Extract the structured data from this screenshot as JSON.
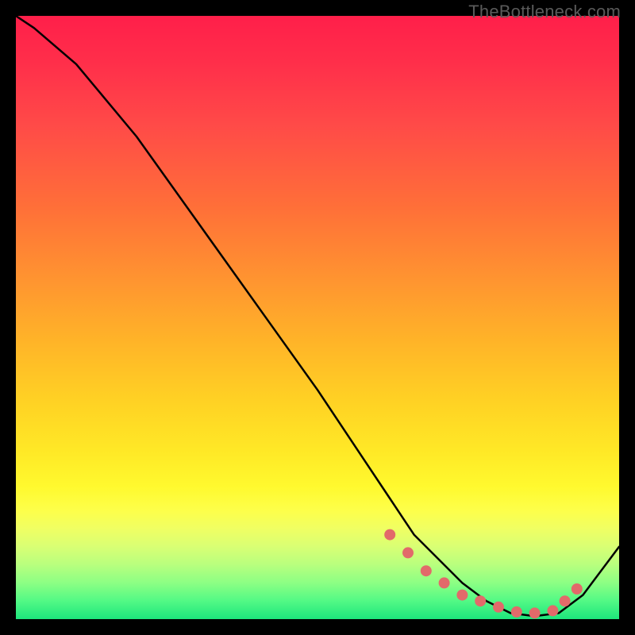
{
  "watermark": "TheBottleneck.com",
  "chart_data": {
    "type": "line",
    "title": "",
    "xlabel": "",
    "ylabel": "",
    "xlim": [
      0,
      100
    ],
    "ylim": [
      0,
      100
    ],
    "series": [
      {
        "name": "bottleneck-curve",
        "x": [
          0,
          3,
          10,
          20,
          30,
          40,
          50,
          58,
          62,
          66,
          70,
          74,
          78,
          82,
          86,
          90,
          94,
          100
        ],
        "values": [
          100,
          98,
          92,
          80,
          66,
          52,
          38,
          26,
          20,
          14,
          10,
          6,
          3,
          1,
          0.5,
          1,
          4,
          12
        ]
      }
    ],
    "markers": {
      "name": "optimal-zone-dots",
      "color": "#e26a6a",
      "x": [
        62,
        65,
        68,
        71,
        74,
        77,
        80,
        83,
        86,
        89,
        91,
        93
      ],
      "values": [
        14,
        11,
        8,
        6,
        4,
        3,
        2,
        1.2,
        1,
        1.4,
        3,
        5
      ]
    }
  }
}
